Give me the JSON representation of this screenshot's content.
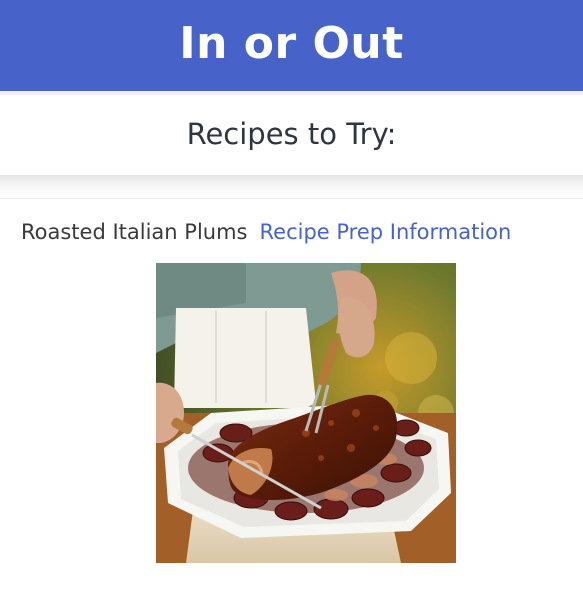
{
  "header": {
    "title": "In or Out",
    "color": "#4762c9"
  },
  "subheader": {
    "title": "Recipes to Try:"
  },
  "recipes": [
    {
      "name": "Roasted Italian Plums",
      "link_label": "Recipe Prep Information",
      "link_color": "#4762c9",
      "image": "roast-pork-with-plums-photo"
    }
  ]
}
